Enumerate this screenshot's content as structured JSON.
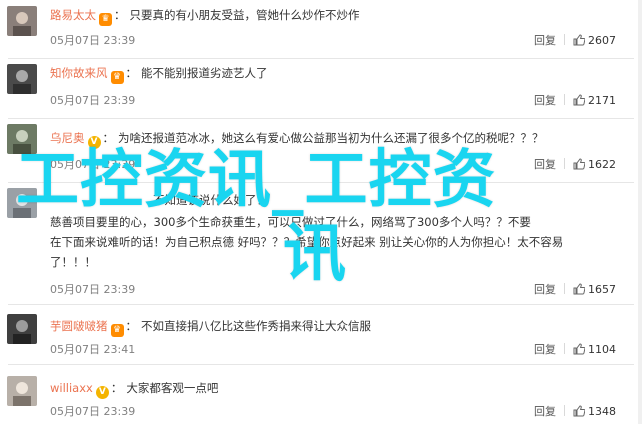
{
  "reply_label": "回复",
  "colon": "：",
  "comments": [
    {
      "user": "路易太太",
      "badge": "crown",
      "text": "只要真的有小朋友受益，管她什么炒作不炒作",
      "extra": [],
      "time": "05月07日 23:39",
      "likes": "2607",
      "avatar_color": "#8a7f7a"
    },
    {
      "user": "知你故来风",
      "badge": "crown",
      "text": "能不能别报道劣迹艺人了",
      "extra": [],
      "time": "05月07日 23:39",
      "likes": "2171",
      "avatar_color": "#4a4a4a"
    },
    {
      "user": "乌尼奥",
      "badge": "v",
      "text": "为啥还报道范冰冰，她这么有爱心做公益那当初为什么还漏了很多个亿的税呢？？？",
      "extra": [],
      "time": "05月07日 23:39",
      "likes": "1622",
      "avatar_color": "#6d7a64"
    },
    {
      "user": "",
      "badge": "",
      "text": "不知道该说什么好了！",
      "extra": [
        "慈善项目要里的心，300多个生命获重生，可以只做过了什么，网络骂了300多个人吗？？不要",
        "在下面来说难听的话！为自己积点德 好吗？？？希望你点好起来 别让关心你的人为你担心！太不容易",
        "了！！！"
      ],
      "time": "05月07日 23:39",
      "likes": "1657",
      "avatar_color": "#9aa0a6"
    },
    {
      "user": "芋圆啵啵猪",
      "badge": "crown",
      "text": "不如直接捐八亿比这些作秀捐来得让大众信服",
      "extra": [],
      "time": "05月07日 23:41",
      "likes": "1104",
      "avatar_color": "#3f3f3f"
    },
    {
      "user": "williaxx",
      "badge": "v",
      "text": "大家都客观一点吧",
      "extra": [],
      "time": "05月07日 23:39",
      "likes": "1348",
      "avatar_color": "#b8b0a8"
    }
  ],
  "watermark": {
    "line1": "工控资讯_工控资",
    "line2": "讯"
  }
}
